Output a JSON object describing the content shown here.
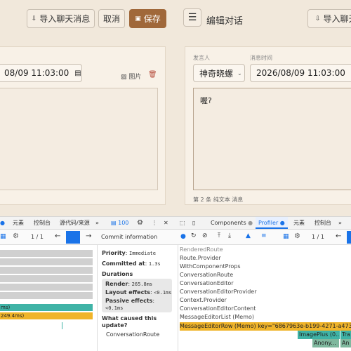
{
  "left_toolbar": {
    "import_label": "导入聊天消息",
    "cancel_label": "取消",
    "save_label": "保存"
  },
  "right_toolbar": {
    "menu_icon": "☰",
    "title": "编辑对话",
    "import_label": "导入聊天"
  },
  "left_panel": {
    "datetime": "08/09 11:03:00",
    "image_label": "图片"
  },
  "right_panel": {
    "speaker_label": "发言人",
    "time_label": "消息时间",
    "speaker_value": "神奇晓螺",
    "datetime": "2026/08/09 11:03:00",
    "message_text": "喔?",
    "footer": "第 2 条 纯文本 消息"
  },
  "devtools_left": {
    "tabs": [
      "元素",
      "控制台",
      "源代码/来源"
    ],
    "more": "»",
    "badge": "100",
    "page": "1 / 1",
    "bars": [
      "ms)",
      "249.4ms)"
    ]
  },
  "commit": {
    "title": "Commit information",
    "priority_label": "Priority",
    "priority_value": "Immediate",
    "committed_label": "Committed at",
    "committed_value": "1.3s",
    "durations_label": "Durations",
    "render_label": "Render",
    "render_value": "265.8ms",
    "layout_label": "Layout effects",
    "layout_value": "<0.1ms",
    "passive_label": "Passive effects",
    "passive_value": "<0.1ms",
    "cause_label": "What caused this update?",
    "cause_value": "ConversationRoute"
  },
  "devtools_right": {
    "tabs": [
      "Components",
      "Profiler",
      "元素",
      "控制台"
    ],
    "page": "1 / 1"
  },
  "tree": [
    "RenderedRoute",
    "Route.Provider",
    "WithComponentProps",
    "ConversationRoute",
    "ConversationEditor",
    "ConversationEditorProvider",
    "Context.Provider",
    "ConversationEditorContent",
    "MessageEditorList (Memo)"
  ],
  "tree_highlight": "MessageEditorRow (Memo) key=\"6867963e-b199-4271-a473-a",
  "tree_children": [
    "ImagePlus (0...",
    "Tra"
  ],
  "tree_grandchildren": [
    "Anony...",
    "An"
  ],
  "colors": {
    "accent": "#a0683a",
    "bg": "#f1e8db",
    "highlight": "#f0b429",
    "teal": "#3fb3a6"
  }
}
